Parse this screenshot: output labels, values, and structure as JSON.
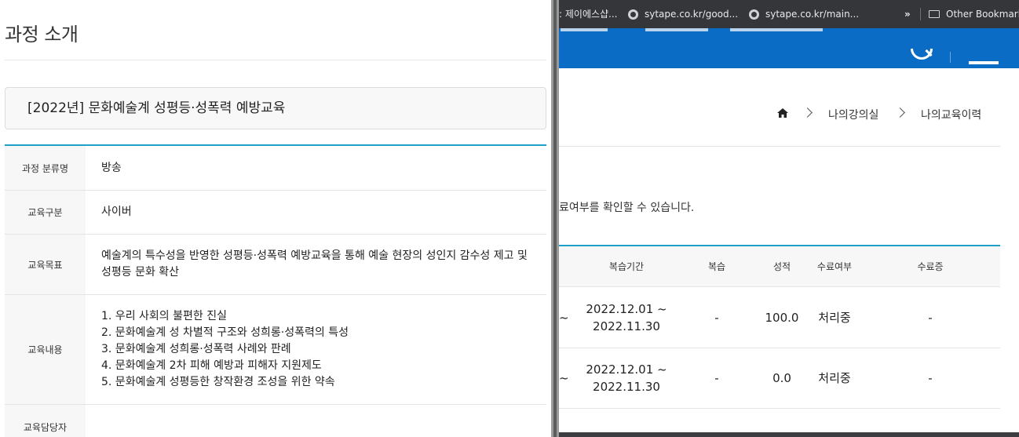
{
  "browser": {
    "bookmarks": [
      {
        "label": ": 제이에스샵..."
      },
      {
        "label": "sytape.co.kr/good..."
      },
      {
        "label": "sytape.co.kr/main..."
      },
      {
        "label": "»"
      },
      {
        "label": "Other Bookmark"
      }
    ]
  },
  "page": {
    "breadcrumb": {
      "items": [
        "나의강의실",
        "나의교육이력"
      ]
    },
    "info_text": "료여부를 확인할 수 있습니다.",
    "history_table": {
      "headers": [
        "복습기간",
        "복습",
        "성적",
        "수료여부",
        "수료증"
      ],
      "rows": [
        {
          "tilde": "~",
          "period": [
            "2022.12.01 ~",
            "2022.11.30"
          ],
          "review": "-",
          "score": "100.0",
          "status": "처리중",
          "cert": "-"
        },
        {
          "tilde": "~",
          "period": [
            "2022.12.01 ~",
            "2022.11.30"
          ],
          "review": "-",
          "score": "0.0",
          "status": "처리중",
          "cert": "-"
        }
      ]
    }
  },
  "modal": {
    "title": "과정 소개",
    "course_name": "[2022년] 문화예술계 성평등·성폭력 예방교육",
    "details": [
      {
        "label": "과정 분류명",
        "lines": [
          "방송"
        ]
      },
      {
        "label": "교육구분",
        "lines": [
          "사이버"
        ]
      },
      {
        "label": "교육목표",
        "lines": [
          "예술계의 특수성을 반영한 성평등·성폭력 예방교육을 통해 예술 현장의 성인지 감수성 제고 및",
          "성평등 문화 확산"
        ]
      },
      {
        "label": "교육내용",
        "lines": [
          "1. 우리 사회의 불편한 진실",
          "2. 문화예술계 성 차별적 구조와 성희롱·성폭력의 특성",
          "3. 문화예술계 성희롱·성폭력 사례와 판례",
          "4. 문화예술계 2차 피해 예방과 피해자 지원제도",
          "5. 문화예술계 성평등한 창작환경 조성을 위한 약속"
        ]
      },
      {
        "label": "교육담당자",
        "lines": []
      }
    ]
  },
  "colors": {
    "header_blue": "#0a6cc4",
    "table_accent": "#1fa0c9",
    "bookmarks_bar": "#35363a"
  }
}
